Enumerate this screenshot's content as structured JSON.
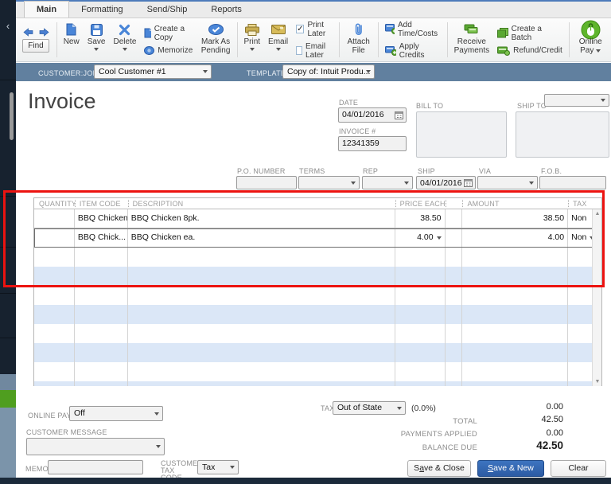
{
  "tabs": [
    "Main",
    "Formatting",
    "Send/Ship",
    "Reports"
  ],
  "toolbar": {
    "find": "Find",
    "new": "New",
    "save": "Save",
    "delete": "Delete",
    "create_copy": "Create a Copy",
    "memorize": "Memorize",
    "mark_pending": "Mark As Pending",
    "print": "Print",
    "email": "Email",
    "print_later": "Print Later",
    "email_later": "Email Later",
    "attach_file": "Attach File",
    "add_time_costs": "Add Time/Costs",
    "apply_credits": "Apply Credits",
    "receive_payments": "Receive Payments",
    "create_batch": "Create a Batch",
    "refund_credit": "Refund/Credit",
    "online_pay": "Online Pay"
  },
  "band": {
    "customer_label": "CUSTOMER:JOB",
    "customer_value": "Cool Customer #1",
    "template_label": "TEMPLATE",
    "template_value": "Copy of: Intuit Produ..."
  },
  "invoice": {
    "title": "Invoice",
    "date_label": "DATE",
    "date": "04/01/2016",
    "number_label": "INVOICE #",
    "number": "12341359",
    "bill_to_label": "BILL TO",
    "ship_to_label": "SHIP TO",
    "po_label": "P.O. NUMBER",
    "terms_label": "TERMS",
    "rep_label": "REP",
    "ship_label": "SHIP",
    "ship_date": "04/01/2016",
    "via_label": "VIA",
    "fob_label": "F.O.B."
  },
  "table": {
    "columns": [
      "QUANTITY",
      "ITEM CODE",
      "DESCRIPTION",
      "PRICE EACH",
      "AMOUNT",
      "TAX"
    ],
    "rows": [
      {
        "quantity": "",
        "item": "BBQ Chicken ...",
        "desc": "BBQ Chicken 8pk.",
        "price": "38.50",
        "amount": "38.50",
        "tax": "Non"
      },
      {
        "quantity": "",
        "item": "BBQ Chick...",
        "desc": "BBQ Chicken ea.",
        "price": "4.00",
        "amount": "4.00",
        "tax": "Non"
      }
    ]
  },
  "footer": {
    "online_pay_label": "ONLINE PAY",
    "online_pay_value": "Off",
    "customer_message_label": "CUSTOMER MESSAGE",
    "memo_label": "MEMO",
    "customer_tax_label": "CUSTOMER TAX CODE",
    "customer_tax_value": "Tax",
    "tax_label": "TAX",
    "tax_value": "Out of State",
    "tax_rate": "(0.0%)",
    "tax_amount": "0.00",
    "total_label": "TOTAL",
    "total_value": "42.50",
    "payments_label": "PAYMENTS APPLIED",
    "payments_value": "0.00",
    "balance_label": "BALANCE DUE",
    "balance_value": "42.50",
    "save_close_pre": "S",
    "save_close_u": "a",
    "save_close_post": "ve & Close",
    "save_new_u": "S",
    "save_new_post": "ave & New",
    "clear": "Clear"
  },
  "colors": {
    "band_blue": "#61809f",
    "accent_blue": "#2c5ba3",
    "row_alt_blue": "#dbe7f7",
    "annotation_red": "#ec1310",
    "icon_green": "#57a62c",
    "icon_gold": "#c2a648"
  }
}
